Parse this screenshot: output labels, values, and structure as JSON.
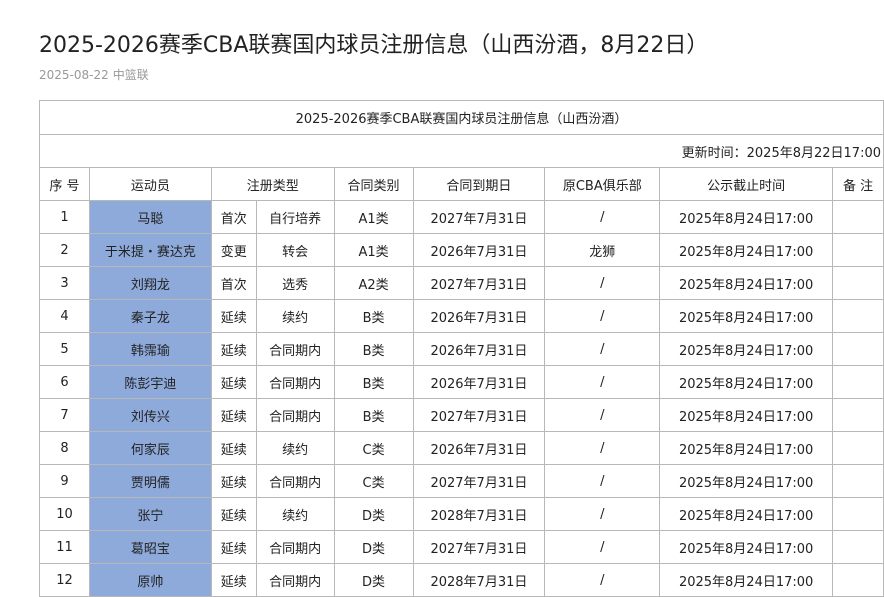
{
  "article": {
    "title": "2025-2026赛季CBA联赛国内球员注册信息（山西汾酒，8月22日）",
    "date": "2025-08-22",
    "source": "中篮联"
  },
  "table": {
    "caption": "2025-2026赛季CBA联赛国内球员注册信息（山西汾酒）",
    "update_time": "更新时间：2025年8月22日17:00",
    "headers": {
      "index": "序 号",
      "athlete": "运动员",
      "reg_type": "注册类型",
      "contract_class": "合同类别",
      "contract_end": "合同到期日",
      "former_club": "原CBA俱乐部",
      "notice_deadline": "公示截止时间",
      "remarks": "备 注"
    },
    "rows": [
      {
        "index": "1",
        "name": "马聪",
        "reg_main": "首次",
        "reg_sub": "自行培养",
        "contract_class": "A1类",
        "contract_end": "2027年7月31日",
        "former_club": "/",
        "deadline": "2025年8月24日17:00",
        "remarks": ""
      },
      {
        "index": "2",
        "name": "于米提・赛达克",
        "reg_main": "变更",
        "reg_sub": "转会",
        "contract_class": "A1类",
        "contract_end": "2026年7月31日",
        "former_club": "龙狮",
        "deadline": "2025年8月24日17:00",
        "remarks": ""
      },
      {
        "index": "3",
        "name": "刘翔龙",
        "reg_main": "首次",
        "reg_sub": "选秀",
        "contract_class": "A2类",
        "contract_end": "2027年7月31日",
        "former_club": "/",
        "deadline": "2025年8月24日17:00",
        "remarks": ""
      },
      {
        "index": "4",
        "name": "秦子龙",
        "reg_main": "延续",
        "reg_sub": "续约",
        "contract_class": "B类",
        "contract_end": "2026年7月31日",
        "former_club": "/",
        "deadline": "2025年8月24日17:00",
        "remarks": ""
      },
      {
        "index": "5",
        "name": "韩霈瑜",
        "reg_main": "延续",
        "reg_sub": "合同期内",
        "contract_class": "B类",
        "contract_end": "2026年7月31日",
        "former_club": "/",
        "deadline": "2025年8月24日17:00",
        "remarks": ""
      },
      {
        "index": "6",
        "name": "陈彭宇迪",
        "reg_main": "延续",
        "reg_sub": "合同期内",
        "contract_class": "B类",
        "contract_end": "2026年7月31日",
        "former_club": "/",
        "deadline": "2025年8月24日17:00",
        "remarks": ""
      },
      {
        "index": "7",
        "name": "刘传兴",
        "reg_main": "延续",
        "reg_sub": "合同期内",
        "contract_class": "B类",
        "contract_end": "2027年7月31日",
        "former_club": "/",
        "deadline": "2025年8月24日17:00",
        "remarks": ""
      },
      {
        "index": "8",
        "name": "何家辰",
        "reg_main": "延续",
        "reg_sub": "续约",
        "contract_class": "C类",
        "contract_end": "2026年7月31日",
        "former_club": "/",
        "deadline": "2025年8月24日17:00",
        "remarks": ""
      },
      {
        "index": "9",
        "name": "贾明儒",
        "reg_main": "延续",
        "reg_sub": "合同期内",
        "contract_class": "C类",
        "contract_end": "2027年7月31日",
        "former_club": "/",
        "deadline": "2025年8月24日17:00",
        "remarks": ""
      },
      {
        "index": "10",
        "name": "张宁",
        "reg_main": "延续",
        "reg_sub": "续约",
        "contract_class": "D类",
        "contract_end": "2028年7月31日",
        "former_club": "/",
        "deadline": "2025年8月24日17:00",
        "remarks": ""
      },
      {
        "index": "11",
        "name": "葛昭宝",
        "reg_main": "延续",
        "reg_sub": "合同期内",
        "contract_class": "D类",
        "contract_end": "2027年7月31日",
        "former_club": "/",
        "deadline": "2025年8月24日17:00",
        "remarks": ""
      },
      {
        "index": "12",
        "name": "原帅",
        "reg_main": "延续",
        "reg_sub": "合同期内",
        "contract_class": "D类",
        "contract_end": "2028年7月31日",
        "former_club": "/",
        "deadline": "2025年8月24日17:00",
        "remarks": ""
      }
    ]
  }
}
